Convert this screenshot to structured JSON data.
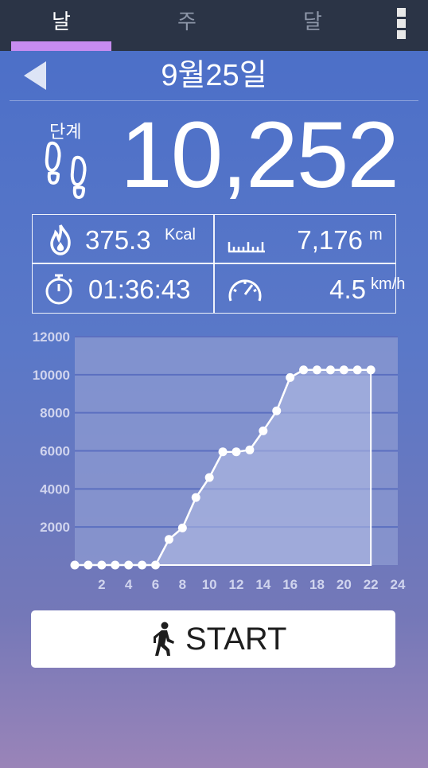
{
  "tabs": [
    {
      "label": "날",
      "active": true
    },
    {
      "label": "주",
      "active": false
    },
    {
      "label": "달",
      "active": false
    }
  ],
  "header": {
    "date": "9월25일"
  },
  "steps": {
    "label": "단계",
    "value": "10,252"
  },
  "stats": {
    "calories": {
      "value": "375.3",
      "unit": "Kcal"
    },
    "distance": {
      "value": "7,176",
      "unit": "m"
    },
    "duration": {
      "value": "01:36:43"
    },
    "speed": {
      "value": "4.5",
      "unit": "km/h"
    }
  },
  "start_button": {
    "label": "START"
  },
  "colors": {
    "accent": "#c78cf0",
    "tabbar": "#2b3446",
    "plot_bg": "#8e9bd2",
    "fill": "#b4bee6"
  },
  "chart_data": {
    "type": "area",
    "x": [
      0,
      1,
      2,
      3,
      4,
      5,
      6,
      7,
      8,
      9,
      10,
      11,
      12,
      13,
      14,
      15,
      16,
      17,
      18,
      19,
      20,
      21,
      22
    ],
    "values": [
      0,
      0,
      0,
      0,
      0,
      0,
      0,
      1350,
      1950,
      3550,
      4600,
      5950,
      5950,
      6050,
      7050,
      8100,
      9850,
      10252,
      10252,
      10252,
      10252,
      10252,
      10252
    ],
    "xticks": [
      "2",
      "4",
      "6",
      "8",
      "10",
      "12",
      "14",
      "16",
      "18",
      "20",
      "22",
      "24"
    ],
    "yticks": [
      "2000",
      "4000",
      "6000",
      "8000",
      "10000",
      "12000"
    ],
    "xlim": [
      0,
      24
    ],
    "ylim": [
      0,
      12000
    ],
    "grid": true
  }
}
